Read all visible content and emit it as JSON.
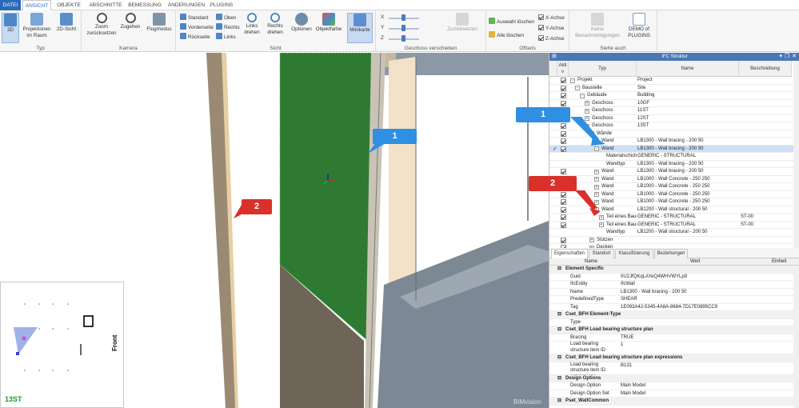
{
  "ribbon": {
    "tabs": [
      "DATEI",
      "ANSICHT",
      "OBJEKTE",
      "ABSCHNITTE",
      "BEMESSUNG",
      "ÄNDERUNGEN",
      "PLUGINS"
    ],
    "active_tab": "ANSICHT",
    "groups": {
      "typ": {
        "label": "Typ",
        "btn3d": "3D",
        "projektionen": "Projektionen im Raum",
        "sicht2d": "2D-Sicht"
      },
      "kamera": {
        "label": "Kamera",
        "zoom": "Zoom zurücksetzen",
        "zugehen": "Zugehen",
        "flugmodus": "Flugmodus"
      },
      "sicht": {
        "label": "Sicht",
        "standard": "Standard",
        "vorderseite": "Vorderseite",
        "rueckseite": "Rückseite",
        "oben": "Oben",
        "rechts": "Rechts",
        "links": "Links",
        "links_drehen": "Links drehen",
        "rechts_drehen": "Rechts drehen",
        "optionen": "Optionen",
        "objektfarbe": "Objektfarbe",
        "minikarte": "Minikarte"
      },
      "geschoss": {
        "label": "Geschoss verschieben",
        "x": "X",
        "y": "Y",
        "z": "Z",
        "zuruecksetzen": "Zurücksetzen"
      },
      "offsets": {
        "label": "Offsets",
        "auswahl_loeschen": "Auswahl löschen",
        "alle_loeschen": "Alle löschen",
        "xachse": "X-Achse",
        "yachse": "Y-Achse",
        "zachse": "Z-Achse"
      },
      "siehe_auch": {
        "label": "Siehe auch",
        "benachrichtigungen": "Keine Benachrichtigungen",
        "demo": "DEMO of PLUGINS"
      }
    }
  },
  "viewport": {
    "callout1": "1",
    "callout2": "2",
    "watermark": "BIMvision",
    "minimap_floor": "13ST",
    "minimap_view": "Front"
  },
  "panel": {
    "title": "IFC Struktur",
    "columns": {
      "aktiv": "Akti v",
      "typ": "Typ",
      "name": "Name",
      "beschreibung": "Beschreibung"
    },
    "callout1": "1",
    "callout2": "2",
    "rows": [
      {
        "typ": "Projekt",
        "name": "Project",
        "beschreibung": ""
      },
      {
        "typ": "Baustelle",
        "name": "Site",
        "beschreibung": ""
      },
      {
        "typ": "Gebäude",
        "name": "Building",
        "beschreibung": ""
      },
      {
        "typ": "Geschoss",
        "name": "10GF",
        "beschreibung": ""
      },
      {
        "typ": "Geschoss",
        "name": "11ST",
        "beschreibung": ""
      },
      {
        "typ": "Geschoss",
        "name": "12ST",
        "beschreibung": ""
      },
      {
        "typ": "Geschoss",
        "name": "13ST",
        "beschreibung": ""
      },
      {
        "typ": "Wände",
        "name": "",
        "beschreibung": ""
      },
      {
        "typ": "Wand",
        "name": "LB1300 - Wall bracing - 200 50",
        "beschreibung": ""
      },
      {
        "typ": "Wand",
        "name": "LB1300 - Wall bracing - 200 50",
        "beschreibung": ""
      },
      {
        "typ": "Materialschicht",
        "name": "GENERIC - STRUCTURAL",
        "beschreibung": ""
      },
      {
        "typ": "Wandtyp",
        "name": "LB1300 - Wall bracing - 200 50",
        "beschreibung": ""
      },
      {
        "typ": "Wand",
        "name": "LB1300 - Wall bracing - 200 50",
        "beschreibung": ""
      },
      {
        "typ": "Wand",
        "name": "LB1000 - Wall Concrete - 250 250",
        "beschreibung": ""
      },
      {
        "typ": "Wand",
        "name": "LB1000 - Wall Concrete - 250 250",
        "beschreibung": ""
      },
      {
        "typ": "Wand",
        "name": "LB1000 - Wall Concrete - 250 250",
        "beschreibung": ""
      },
      {
        "typ": "Wand",
        "name": "LB1000 - Wall Concrete - 250 250",
        "beschreibung": ""
      },
      {
        "typ": "Wand",
        "name": "LB1200 - Wall structural - 200 50",
        "beschreibung": ""
      },
      {
        "typ": "Teil eines Baue...",
        "name": "GENERIC - STRUCTURAL",
        "beschreibung": "ST-00"
      },
      {
        "typ": "Teil eines Baue...",
        "name": "GENERIC - STRUCTURAL",
        "beschreibung": "ST-00"
      },
      {
        "typ": "Wandtyp",
        "name": "LB1200 - Wall structural - 200 50",
        "beschreibung": ""
      },
      {
        "typ": "Stützen",
        "name": "",
        "beschreibung": ""
      },
      {
        "typ": "Decken",
        "name": "",
        "beschreibung": ""
      }
    ],
    "prop_tabs": [
      "Eigenschaften",
      "Standort",
      "Klassifizierung",
      "Beziehungen"
    ],
    "prop_columns": {
      "name": "Name",
      "wert": "Wert",
      "einheit": "Einheit"
    },
    "props": [
      {
        "section": "Element Specific"
      },
      {
        "name": "Guid",
        "wert": "0U2JfQKqLAYeQ4WHVWYLp9"
      },
      {
        "name": "IfcEntity",
        "wert": "IfcWall"
      },
      {
        "name": "Name",
        "wert": "LB1300 - Wall bracing - 200 50"
      },
      {
        "name": "PredefinedType",
        "wert": "SHEAR"
      },
      {
        "name": "Tag",
        "wert": "1E093A42-5345-4A8A-8684-7D17E0895CC9"
      },
      {
        "section": "Cset_BFH Element-Type"
      },
      {
        "name": "Type",
        "wert": ""
      },
      {
        "section": "Cset_BFH Load bearing structure plan"
      },
      {
        "name": "Bracing",
        "wert": "TRUE"
      },
      {
        "name": "Load bearing structure item ID",
        "wert": "1"
      },
      {
        "section": "Cset_BFH Load bearing structure plan expressions"
      },
      {
        "name": "Load bearing structure item ID expressions",
        "wert": "B131"
      },
      {
        "section": "Design Options"
      },
      {
        "name": "Design Option",
        "wert": "Main Model"
      },
      {
        "name": "Design Option Set",
        "wert": "Main Model"
      },
      {
        "section": "Pset_WallCommon"
      }
    ]
  }
}
